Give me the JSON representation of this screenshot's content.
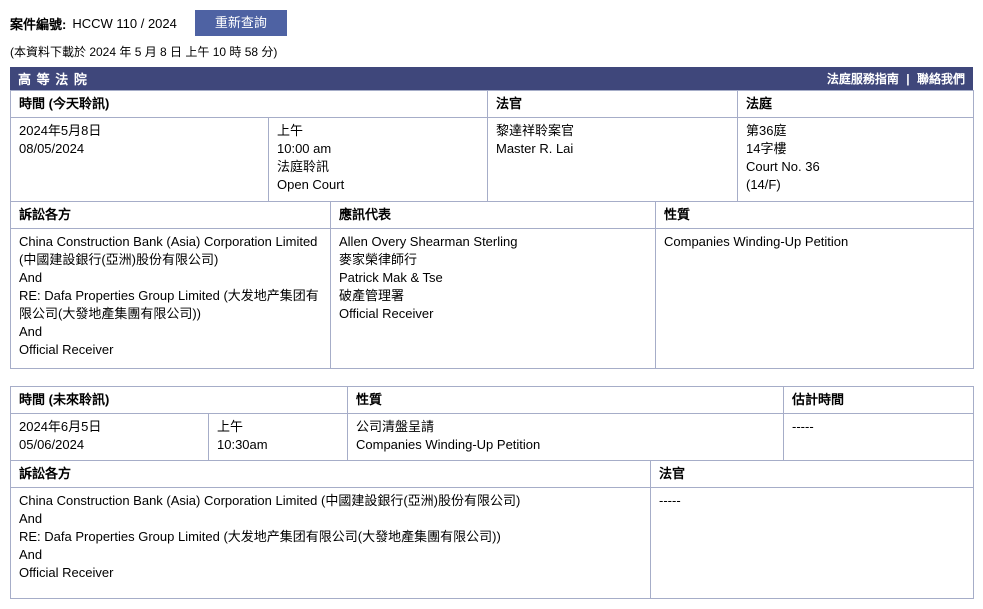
{
  "top": {
    "case_label": "案件編號:",
    "case_number": "HCCW 110 / 2024",
    "requery_button": "重新查詢",
    "download_note": "(本資料下載於 2024 年 5 月 8 日 上午 10 時 58 分)"
  },
  "banner": {
    "title": "高 等 法 院",
    "link_guide": "法庭服務指南",
    "link_separator": "|",
    "link_contact": "聯絡我們"
  },
  "today_table": {
    "time_header": "時間 (今天聆訊)",
    "judge_header": "法官",
    "court_header": "法庭",
    "date": [
      "2024年5月8日",
      "08/05/2024"
    ],
    "session": [
      "上午",
      "10:00 am",
      "法庭聆訊",
      "Open Court"
    ],
    "judge": [
      "黎達祥聆案官",
      "Master R. Lai"
    ],
    "court": [
      "第36庭",
      "14字樓",
      "Court No. 36",
      "(14/F)"
    ],
    "parties_header": "訴訟各方",
    "representatives_header": "應訊代表",
    "nature_header": "性質",
    "parties": [
      "China Construction Bank (Asia) Corporation Limited (中國建設銀行(亞洲)股份有限公司)",
      "And",
      "RE: Dafa Properties Group Limited (大发地产集团有限公司(大發地產集團有限公司))",
      "And",
      "Official Receiver"
    ],
    "representatives": [
      "Allen Overy Shearman Sterling",
      "麥家榮律師行",
      "Patrick Mak & Tse",
      "破產管理署",
      "Official Receiver"
    ],
    "nature": "Companies Winding-Up Petition"
  },
  "future_table": {
    "time_header": "時間 (未來聆訊)",
    "nature_header": "性質",
    "estimated_header": "估計時間",
    "date": [
      "2024年6月5日",
      "05/06/2024"
    ],
    "session": [
      "上午",
      "10:30am"
    ],
    "nature": [
      "公司清盤呈請",
      "Companies Winding-Up Petition"
    ],
    "estimated": "-----",
    "parties_header": "訴訟各方",
    "judge_header": "法官",
    "parties": [
      "China Construction Bank (Asia) Corporation Limited (中國建設銀行(亞洲)股份有限公司)",
      "And",
      "RE: Dafa Properties Group Limited (大发地产集团有限公司(大發地產集團有限公司))",
      "And",
      "Official Receiver"
    ],
    "judge": "-----"
  },
  "colors": {
    "banner_bg": "#3F477B",
    "button_bg": "#4E62A3",
    "table_border": "#A6ADC8"
  }
}
